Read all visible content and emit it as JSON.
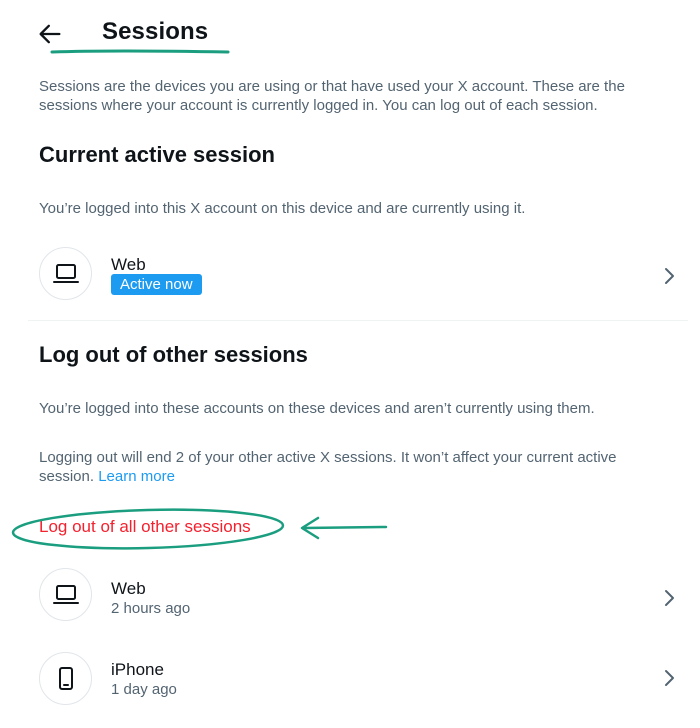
{
  "header": {
    "back_icon": "arrow-left-icon",
    "title": "Sessions"
  },
  "intro": "Sessions are the devices you are using or that have used your X account. These are the sessions where your account is currently logged in. You can log out of each session.",
  "current": {
    "heading": "Current active session",
    "description": "You’re logged into this X account on this device and are currently using it.",
    "session": {
      "device_icon": "laptop-icon",
      "name": "Web",
      "badge": "Active now"
    }
  },
  "other": {
    "heading": "Log out of other sessions",
    "description": "You’re logged into these accounts on these devices and aren’t currently using them.",
    "warning": "Logging out will end 2 of your other active X sessions. It won’t affect your current active session.",
    "learn_more": "Learn more",
    "logout_all": "Log out of all other sessions",
    "sessions": [
      {
        "device_icon": "laptop-icon",
        "name": "Web",
        "time": "2 hours ago"
      },
      {
        "device_icon": "phone-icon",
        "name": "iPhone",
        "time": "1 day ago"
      }
    ]
  },
  "colors": {
    "accent": "#1d9bf0",
    "danger": "#f4212e",
    "annotation": "#1a9e7f",
    "muted_text": "#536471"
  }
}
